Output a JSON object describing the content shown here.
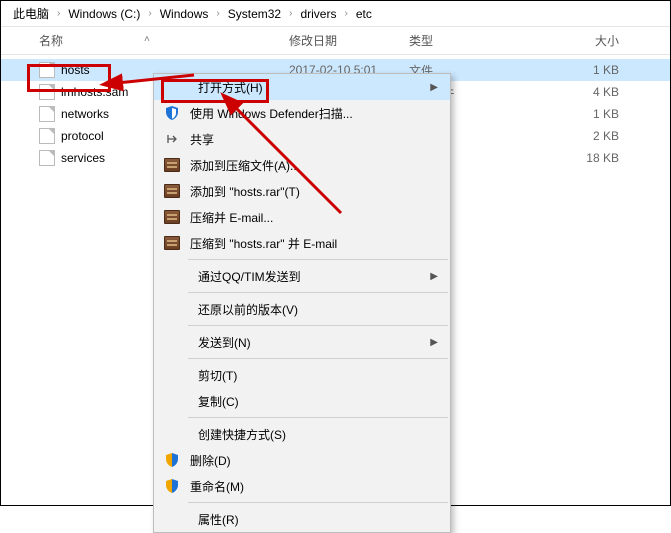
{
  "breadcrumb": [
    "此电脑",
    "Windows (C:)",
    "Windows",
    "System32",
    "drivers",
    "etc"
  ],
  "columns": {
    "name": "名称",
    "date": "修改日期",
    "type": "类型",
    "size": "大小"
  },
  "files": [
    {
      "name": "hosts",
      "date": "2017-02-10 5:01",
      "type": "文件",
      "size": "1 KB",
      "selected": true
    },
    {
      "name": "lmhosts.sam",
      "date": "",
      "type": "AM 文件",
      "size": "4 KB"
    },
    {
      "name": "networks",
      "date": "",
      "type": "件",
      "size": "1 KB"
    },
    {
      "name": "protocol",
      "date": "",
      "type": "件",
      "size": "2 KB"
    },
    {
      "name": "services",
      "date": "",
      "type": "件",
      "size": "18 KB"
    }
  ],
  "menu": {
    "open_with": "打开方式(H)",
    "defender": "使用 Windows Defender扫描...",
    "share": "共享",
    "add_to_zip": "添加到压缩文件(A)...",
    "add_to_hosts_rar": "添加到 \"hosts.rar\"(T)",
    "compress_email": "压缩并 E-mail...",
    "compress_hosts_email": "压缩到 \"hosts.rar\" 并 E-mail",
    "qq_tim": "通过QQ/TIM发送到",
    "restore_prev": "还原以前的版本(V)",
    "send_to": "发送到(N)",
    "cut": "剪切(T)",
    "copy": "复制(C)",
    "shortcut": "创建快捷方式(S)",
    "delete": "删除(D)",
    "rename": "重命名(M)",
    "properties": "属性(R)"
  }
}
